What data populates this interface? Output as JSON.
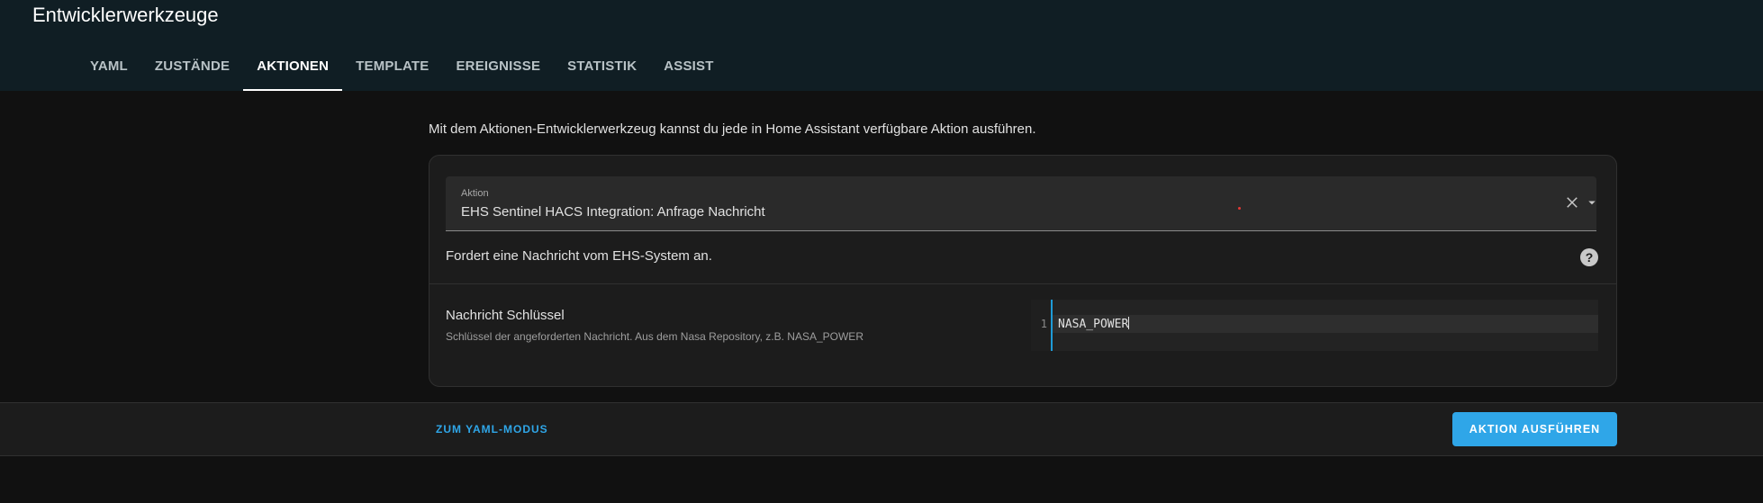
{
  "app": {
    "title": "Entwicklerwerkzeuge"
  },
  "tabs": [
    {
      "label": "YAML",
      "active": false
    },
    {
      "label": "ZUSTÄNDE",
      "active": false
    },
    {
      "label": "AKTIONEN",
      "active": true
    },
    {
      "label": "TEMPLATE",
      "active": false
    },
    {
      "label": "EREIGNISSE",
      "active": false
    },
    {
      "label": "STATISTIK",
      "active": false
    },
    {
      "label": "ASSIST",
      "active": false
    }
  ],
  "main": {
    "intro": "Mit dem Aktionen-Entwicklerwerkzeug kannst du jede in Home Assistant verfügbare Aktion ausführen."
  },
  "action_select": {
    "label": "Aktion",
    "value": "EHS Sentinel HACS Integration: Anfrage Nachricht",
    "clear_icon": "close-icon",
    "dropdown_icon": "menu-down-icon"
  },
  "action_description": {
    "text": "Fordert eine Nachricht vom EHS-System an.",
    "icon": "help-circle-icon"
  },
  "field": {
    "title": "Nachricht Schlüssel",
    "helper": "Schlüssel der angeforderten Nachricht. Aus dem Nasa Repository, z.B. NASA_POWER",
    "line_number": "1",
    "value": "NASA_POWER"
  },
  "footer": {
    "yaml_mode_label": "ZUM YAML-MODUS",
    "run_label": "AKTION AUSFÜHREN"
  },
  "colors": {
    "accent": "#2fa6e8",
    "header_bg": "#101e24",
    "page_bg": "#111111",
    "card_bg": "#1c1c1c"
  }
}
